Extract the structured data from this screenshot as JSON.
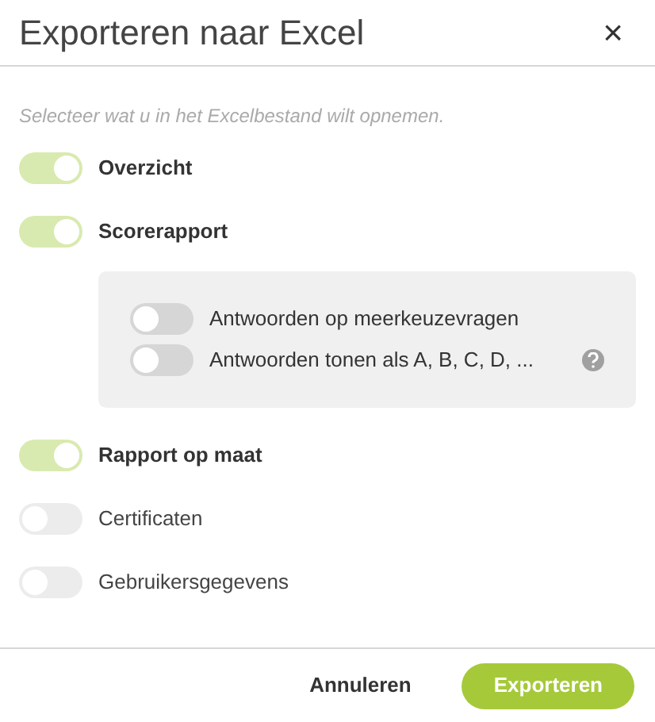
{
  "dialog": {
    "title": "Exporteren naar Excel",
    "close": "×"
  },
  "instruction": "Selecteer wat u in het Excelbestand wilt opnemen.",
  "options": [
    {
      "label": "Overzicht",
      "on": true
    },
    {
      "label": "Scorerapport",
      "on": true,
      "children": [
        {
          "label": "Antwoorden op meerkeuzevragen",
          "on": false,
          "help": false
        },
        {
          "label": "Antwoorden tonen als A, B, C, D, ...",
          "on": false,
          "help": true
        }
      ]
    },
    {
      "label": "Rapport op maat",
      "on": true
    },
    {
      "label": "Certificaten",
      "on": false
    },
    {
      "label": "Gebruikersgegevens",
      "on": false
    }
  ],
  "buttons": [
    {
      "label": "Annuleren",
      "kind": "secondary"
    },
    {
      "label": "Exporteren",
      "kind": "primary"
    }
  ]
}
